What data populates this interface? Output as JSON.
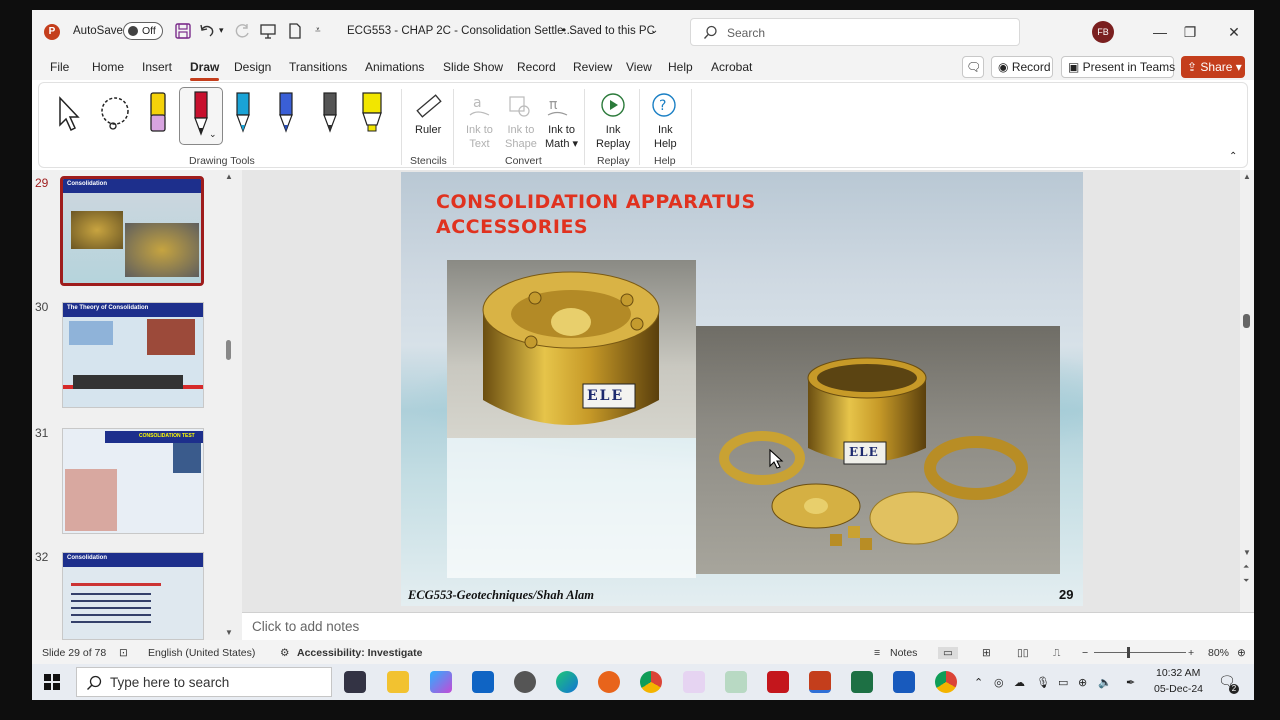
{
  "titlebar": {
    "autosave_label": "AutoSave",
    "autosave_state": "Off",
    "doc_title": "ECG553 - CHAP 2C - Consolidation Settle...",
    "save_status": "• Saved to this PC",
    "search_placeholder": "Search",
    "user_initials": "FB"
  },
  "menu": {
    "tabs": [
      "File",
      "Home",
      "Insert",
      "Draw",
      "Design",
      "Transitions",
      "Animations",
      "Slide Show",
      "Record",
      "Review",
      "View",
      "Help",
      "Acrobat"
    ],
    "active": "Draw",
    "record_label": "Record",
    "present_label": "Present in Teams",
    "share_label": "Share"
  },
  "ribbon": {
    "groups": {
      "drawing_tools": "Drawing Tools",
      "stencils": "Stencils",
      "convert": "Convert",
      "replay": "Replay",
      "help": "Help"
    },
    "ruler": "Ruler",
    "ink_to_text": [
      "Ink to",
      "Text"
    ],
    "ink_to_shape": [
      "Ink to",
      "Shape"
    ],
    "ink_to_math": [
      "Ink to",
      "Math"
    ],
    "ink_replay": [
      "Ink",
      "Replay"
    ],
    "ink_help": [
      "Ink",
      "Help"
    ],
    "pen_colors": [
      "#f4d20a",
      "#c8102e",
      "#1aa3d6",
      "#3a8fd6",
      "#444444",
      "#f2e600"
    ]
  },
  "thumbnails": {
    "numbers": [
      "29",
      "30",
      "31",
      "32"
    ],
    "titles": [
      "Consolidation",
      "The Theory of Consolidation",
      "CONSOLIDATION TEST",
      "Consolidation"
    ]
  },
  "slide": {
    "title_line1": "CONSOLIDATION APPARATUS",
    "title_line2": "ACCESSORIES",
    "footer": "ECG553-Geotechniques/Shah Alam",
    "number": "29",
    "brand_label": "ELE"
  },
  "notes_placeholder": "Click to add notes",
  "status": {
    "slide_count": "Slide 29 of 78",
    "language": "English (United States)",
    "accessibility": "Accessibility: Investigate",
    "notes": "Notes",
    "zoom": "80%"
  },
  "taskbar": {
    "search_placeholder": "Type here to search",
    "time": "10:32 AM",
    "date": "05-Dec-24",
    "notif_count": "2"
  }
}
